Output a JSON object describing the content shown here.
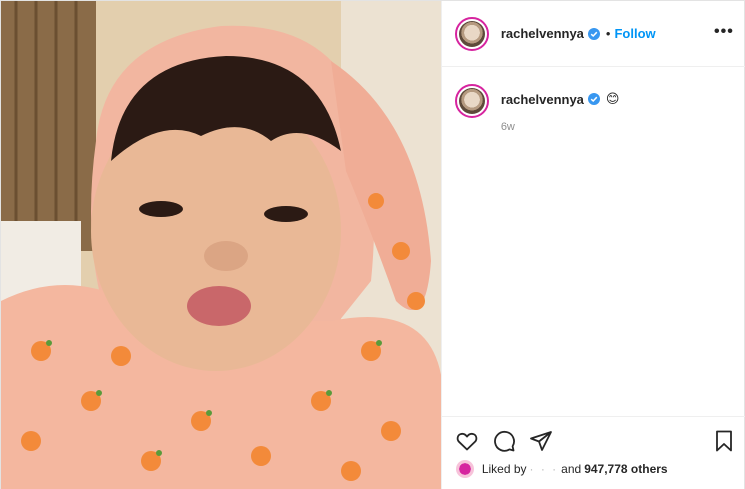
{
  "post": {
    "username": "rachelvennya",
    "follow_label": "Follow",
    "separator": "•",
    "more_label": "•••",
    "caption_emoji": "😊",
    "time_ago": "6w",
    "likes_prefix": "Liked by",
    "likes_hidden": "· · ·",
    "likes_and": "and",
    "likes_count": "947,778 others"
  },
  "icons": [
    "heart-icon",
    "comment-icon",
    "share-icon",
    "bookmark-icon",
    "verified-badge-icon",
    "more-options-icon"
  ],
  "colors": {
    "follow": "#0095f6",
    "verified": "#3897f0",
    "story_ring": "#d6249f",
    "muted": "#8e8e8e"
  }
}
